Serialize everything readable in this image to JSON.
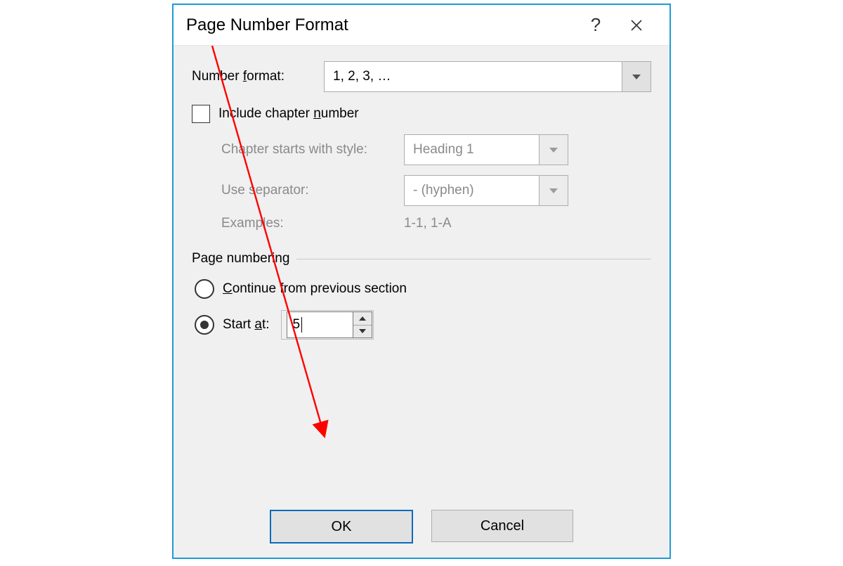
{
  "title": "Page Number Format",
  "number_format": {
    "label_pre": "Number ",
    "label_u": "f",
    "label_post": "ormat:",
    "value": "1, 2, 3, …"
  },
  "include_chapter": {
    "pre": "Include chapter ",
    "u": "n",
    "post": "umber",
    "checked": false
  },
  "chapter": {
    "style_label": "Chapter starts with style:",
    "style_value": "Heading 1",
    "sep_label": "Use separator:",
    "sep_value": "-   (hyphen)",
    "examples_label": "Examples:",
    "examples_value": "1-1, 1-A"
  },
  "numbering": {
    "heading": "Page numbering",
    "continue": {
      "u": "C",
      "post": "ontinue from previous section"
    },
    "start": {
      "pre": "Start ",
      "u": "a",
      "post": "t:"
    },
    "start_value": "5",
    "selected": "start"
  },
  "buttons": {
    "ok": "OK",
    "cancel": "Cancel"
  }
}
